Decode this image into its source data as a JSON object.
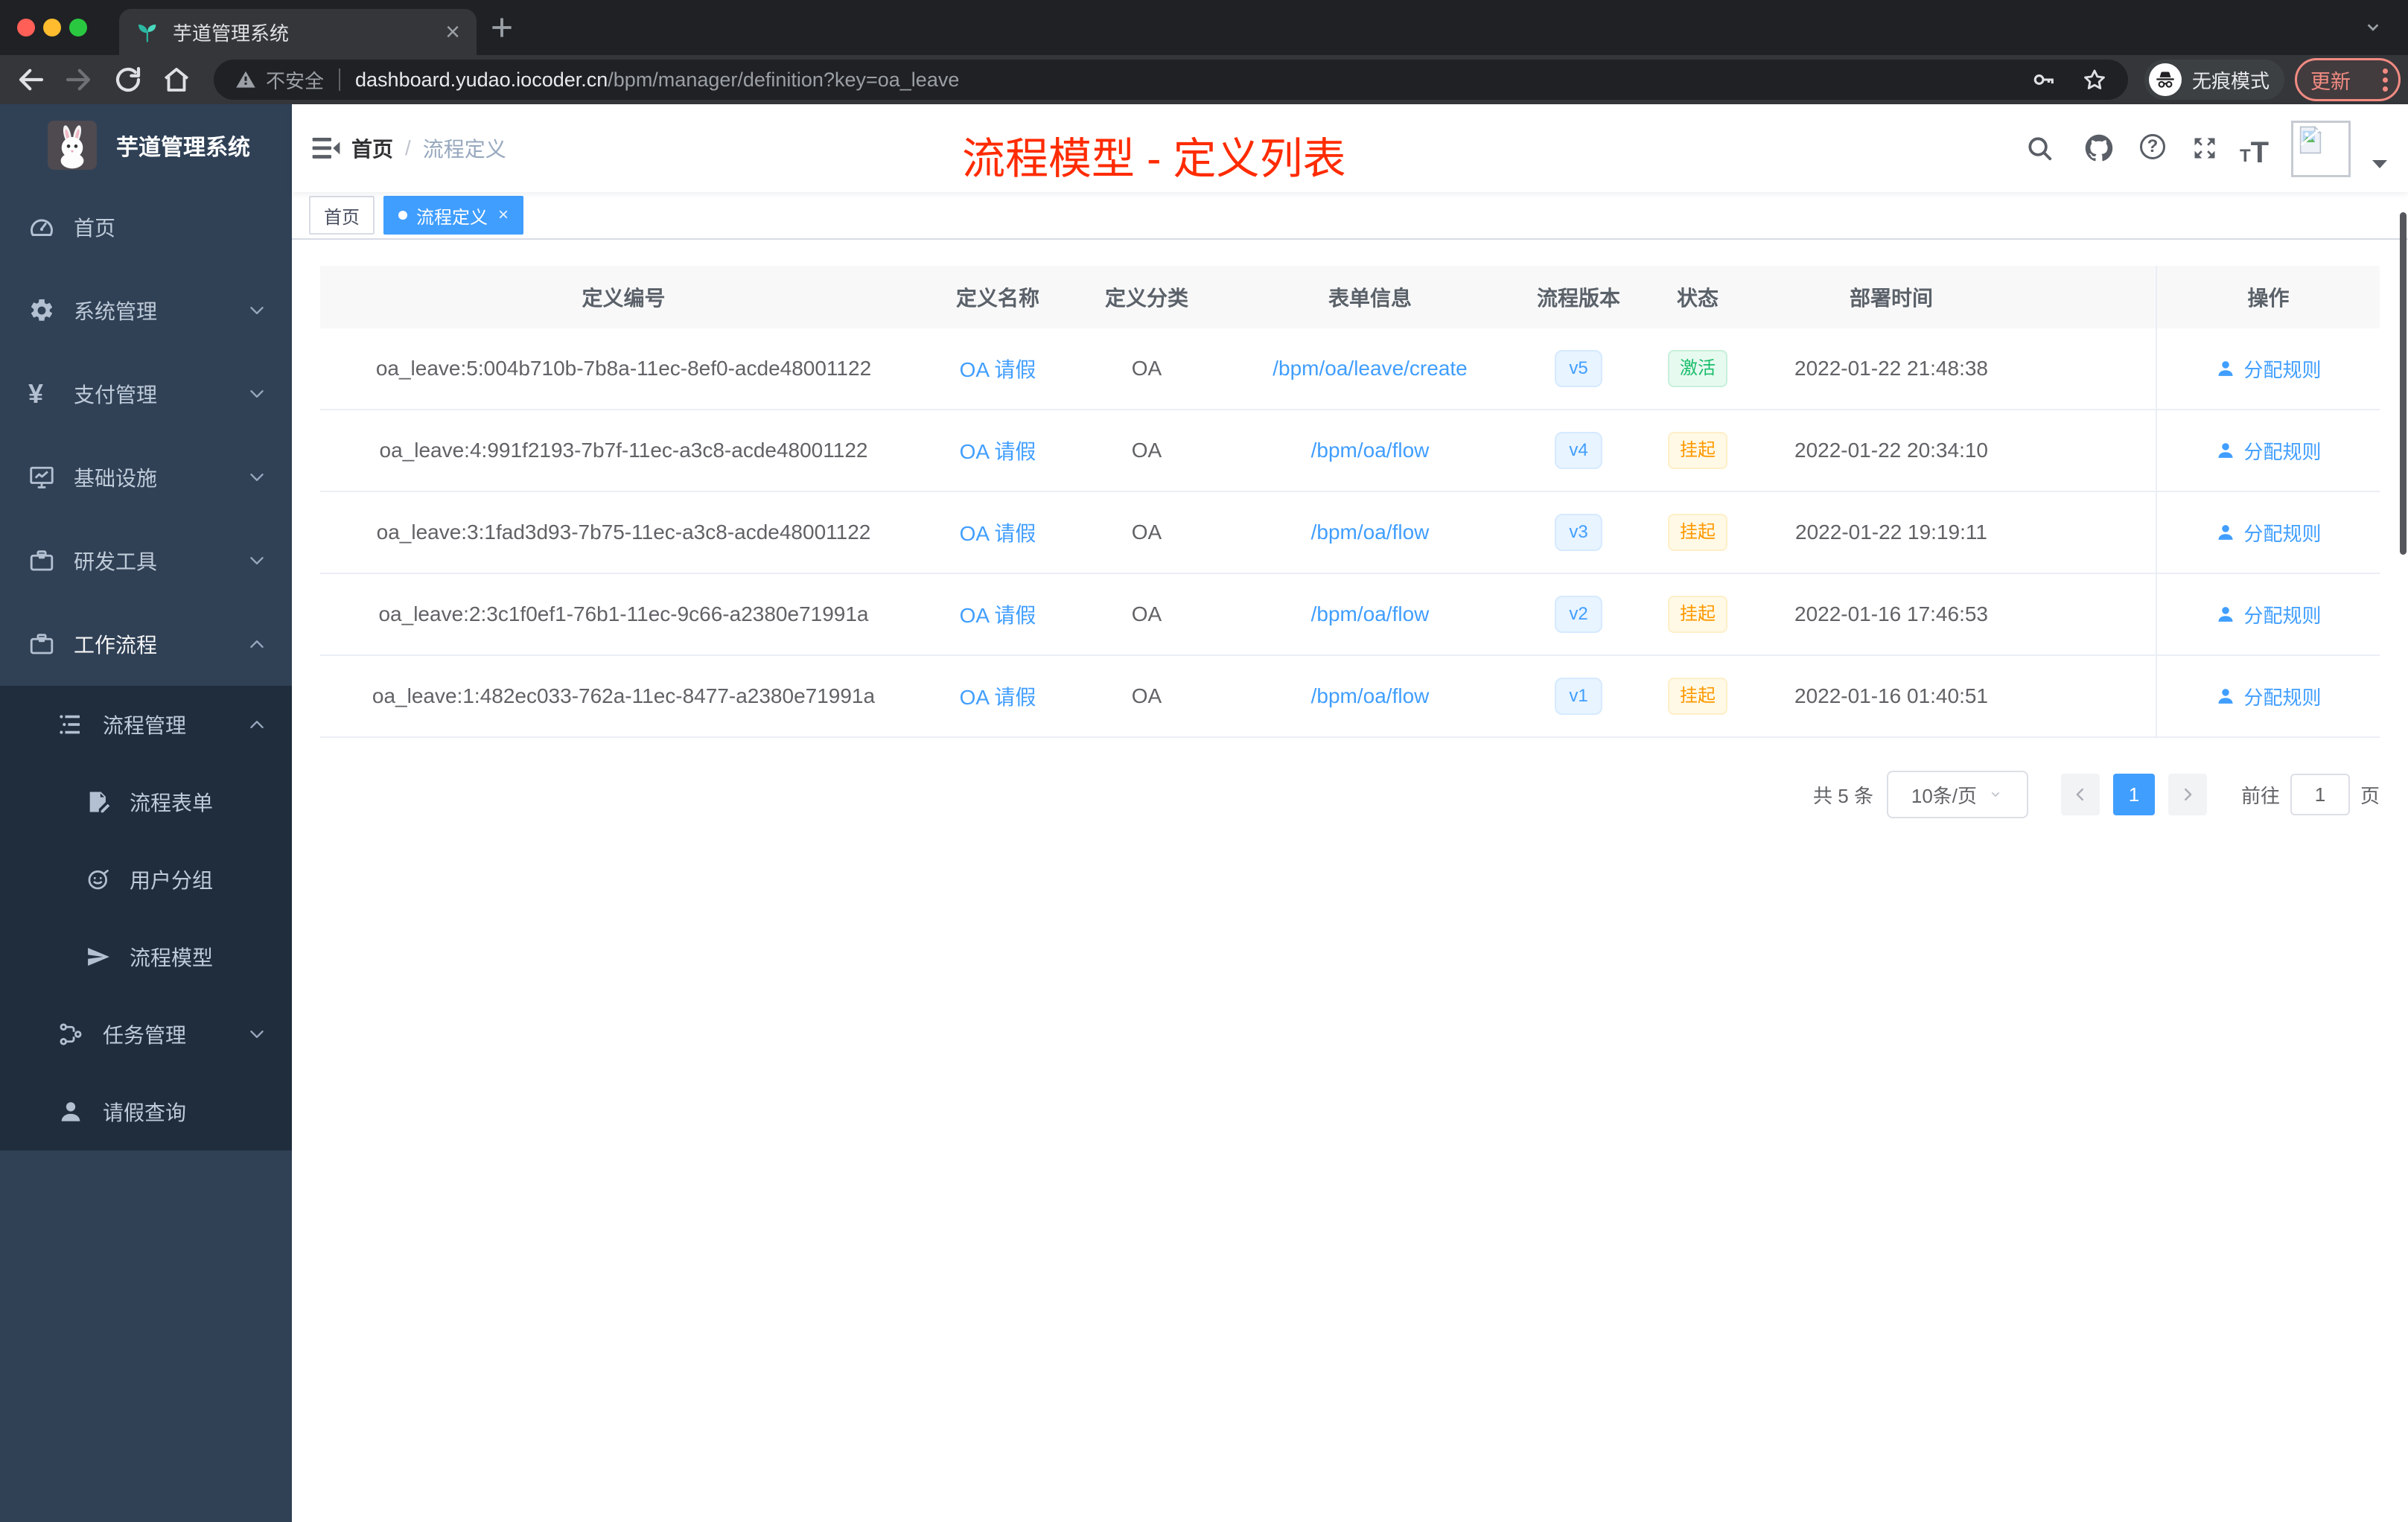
{
  "browser": {
    "tab_title": "芋道管理系统",
    "security_label": "不安全",
    "url_host": "dashboard.yudao.iocoder.cn",
    "url_path": "/bpm/manager/definition?key=oa_leave",
    "incognito_label": "无痕模式",
    "update_label": "更新",
    "new_tab_glyph": "+",
    "close_tab_glyph": "×"
  },
  "sidebar": {
    "logo_title": "芋道管理系统",
    "items": [
      {
        "label": "首页",
        "icon": "dashboard-icon",
        "level": 1,
        "arrow": null
      },
      {
        "label": "系统管理",
        "icon": "gear-icon",
        "level": 1,
        "arrow": "down"
      },
      {
        "label": "支付管理",
        "icon": "yen-icon",
        "level": 1,
        "arrow": "down"
      },
      {
        "label": "基础设施",
        "icon": "monitor-icon",
        "level": 1,
        "arrow": "down"
      },
      {
        "label": "研发工具",
        "icon": "toolbox-icon",
        "level": 1,
        "arrow": "down"
      },
      {
        "label": "工作流程",
        "icon": "briefcase-icon",
        "level": 1,
        "arrow": "up",
        "open": true
      },
      {
        "label": "流程管理",
        "icon": "tree-list-icon",
        "level": 2,
        "arrow": "up",
        "in_submenu": true
      },
      {
        "label": "流程表单",
        "icon": "form-edit-icon",
        "level": 3,
        "arrow": null,
        "in_submenu": true
      },
      {
        "label": "用户分组",
        "icon": "robot-icon",
        "level": 3,
        "arrow": null,
        "in_submenu": true
      },
      {
        "label": "流程模型",
        "icon": "paper-plane-icon",
        "level": 3,
        "arrow": null,
        "in_submenu": true
      },
      {
        "label": "任务管理",
        "icon": "flow-icon",
        "level": 2,
        "arrow": "down",
        "in_submenu": true
      },
      {
        "label": "请假查询",
        "icon": "user-icon",
        "level": 2,
        "arrow": null,
        "in_submenu": true
      }
    ]
  },
  "navbar": {
    "breadcrumb_home": "首页",
    "breadcrumb_separator": "/",
    "breadcrumb_current": "流程定义",
    "annotation": "流程模型 - 定义列表",
    "annotation_color": "#ff2b00"
  },
  "tags": {
    "home_label": "首页",
    "active_label": "流程定义",
    "active_close_glyph": "×"
  },
  "table": {
    "columns": [
      "定义编号",
      "定义名称",
      "定义分类",
      "表单信息",
      "流程版本",
      "状态",
      "部署时间",
      "操作"
    ],
    "rows": [
      {
        "id": "oa_leave:5:004b710b-7b8a-11ec-8ef0-acde48001122",
        "name": "OA 请假",
        "category": "OA",
        "form": "/bpm/oa/leave/create",
        "version": "v5",
        "status": "激活",
        "status_type": "success",
        "time": "2022-01-22 21:48:38",
        "action": "分配规则"
      },
      {
        "id": "oa_leave:4:991f2193-7b7f-11ec-a3c8-acde48001122",
        "name": "OA 请假",
        "category": "OA",
        "form": "/bpm/oa/flow",
        "version": "v4",
        "status": "挂起",
        "status_type": "warning",
        "time": "2022-01-22 20:34:10",
        "action": "分配规则"
      },
      {
        "id": "oa_leave:3:1fad3d93-7b75-11ec-a3c8-acde48001122",
        "name": "OA 请假",
        "category": "OA",
        "form": "/bpm/oa/flow",
        "version": "v3",
        "status": "挂起",
        "status_type": "warning",
        "time": "2022-01-22 19:19:11",
        "action": "分配规则"
      },
      {
        "id": "oa_leave:2:3c1f0ef1-76b1-11ec-9c66-a2380e71991a",
        "name": "OA 请假",
        "category": "OA",
        "form": "/bpm/oa/flow",
        "version": "v2",
        "status": "挂起",
        "status_type": "warning",
        "time": "2022-01-16 17:46:53",
        "action": "分配规则"
      },
      {
        "id": "oa_leave:1:482ec033-762a-11ec-8477-a2380e71991a",
        "name": "OA 请假",
        "category": "OA",
        "form": "/bpm/oa/flow",
        "version": "v1",
        "status": "挂起",
        "status_type": "warning",
        "time": "2022-01-16 01:40:51",
        "action": "分配规则"
      }
    ]
  },
  "pagination": {
    "total_label": "共 5 条",
    "page_size_label": "10条/页",
    "current_page": "1",
    "jump_prefix": "前往",
    "jump_value": "1",
    "jump_suffix": "页"
  },
  "colors": {
    "accent_blue": "#409eff",
    "sidebar_bg": "#304156",
    "submenu_bg": "#1f2d3d",
    "success_green": "#19be6b",
    "warning_orange": "#ff9900",
    "update_red": "#f28b82"
  }
}
